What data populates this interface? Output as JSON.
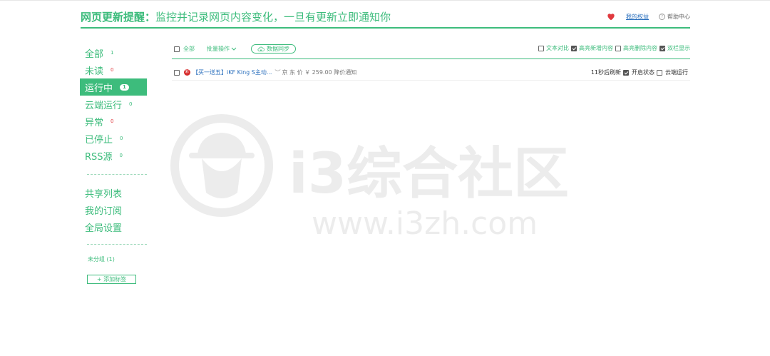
{
  "header": {
    "title_strong": "网页更新提醒：",
    "title_sub": "监控并记录网页内容变化，一旦有更新立即通知你",
    "rights_link": "我的权益",
    "help_label": "帮助中心",
    "help_icon_glyph": "?"
  },
  "sidebar": {
    "items": [
      {
        "label": "全部",
        "count": "1"
      },
      {
        "label": "未读",
        "count": "0"
      },
      {
        "label": "运行中",
        "count": "1"
      },
      {
        "label": "云端运行",
        "count": "0"
      },
      {
        "label": "异常",
        "count": "0"
      },
      {
        "label": "已停止",
        "count": "0"
      },
      {
        "label": "RSS源",
        "count": "0"
      }
    ],
    "links": [
      {
        "label": "共享列表"
      },
      {
        "label": "我的订阅"
      },
      {
        "label": "全局设置"
      }
    ],
    "group_label": "未分组",
    "group_count": "(1)",
    "add_tag_label": "+ 添加标签"
  },
  "toolbar": {
    "select_all_label": "全部",
    "batch_label": "批量操作",
    "sync_label": "数据同步",
    "options": [
      {
        "label": "文本对比",
        "checked": false
      },
      {
        "label": "高亮新增内容",
        "checked": true
      },
      {
        "label": "高亮删除内容",
        "checked": false
      },
      {
        "label": "双栏显示",
        "checked": true
      }
    ]
  },
  "rows": [
    {
      "badge": "彩",
      "title": "【买一送五】iKF King S主动...",
      "meta": "京 东 价 ￥ 259.00 降价通知",
      "refresh": "11秒后刷新",
      "enabled_label": "开启状态",
      "enabled": true,
      "cloud_label": "云端运行",
      "cloud": false
    }
  ],
  "watermark": {
    "brand": "i3综合社区",
    "url": "www.i3zh.com"
  },
  "colors": {
    "accent": "#3dbc7c",
    "link": "#2a6fbd",
    "alert": "#e0393e"
  }
}
